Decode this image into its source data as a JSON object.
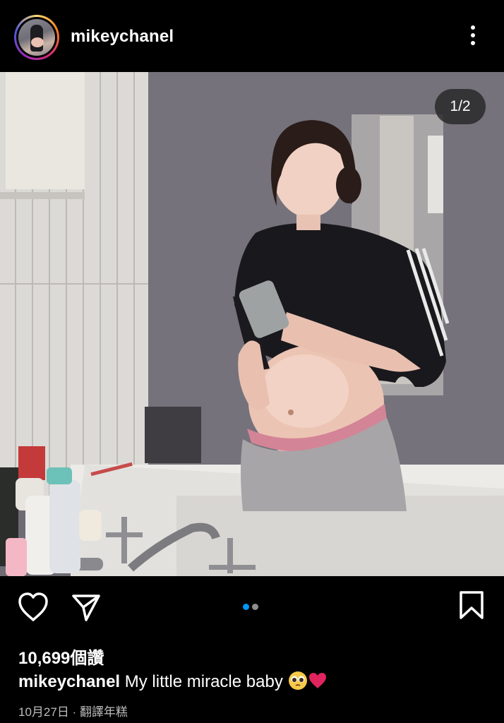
{
  "post": {
    "username": "mikeychanel",
    "image_counter": "1/2",
    "likes": "10,699個讚",
    "caption_user": "mikeychanel",
    "caption_text": " My little miracle baby ",
    "date": "10月27日",
    "separator": " · ",
    "translate": "翻譯年糕"
  },
  "carousel": {
    "current": 1,
    "total": 2
  },
  "icons": {
    "more": "more-vertical-icon",
    "like": "heart-icon",
    "share": "send-icon",
    "save": "bookmark-icon",
    "emoji1": "pleading-face-emoji",
    "emoji2": "red-heart-emoji"
  },
  "colors": {
    "background": "#000000",
    "accent": "#0095f6",
    "heart": "#e0245e"
  }
}
